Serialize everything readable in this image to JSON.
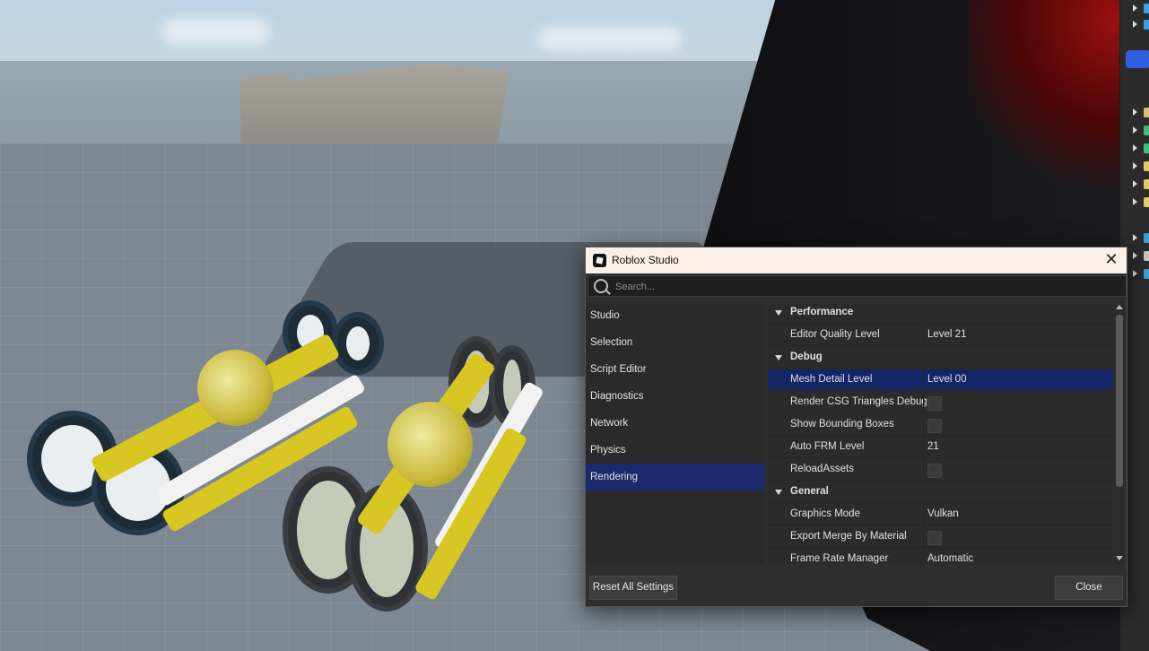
{
  "dialog": {
    "title": "Roblox Studio",
    "search": {
      "placeholder": "Search...",
      "value": ""
    },
    "categories": [
      {
        "label": "Studio",
        "active": false
      },
      {
        "label": "Selection",
        "active": false
      },
      {
        "label": "Script Editor",
        "active": false
      },
      {
        "label": "Diagnostics",
        "active": false
      },
      {
        "label": "Network",
        "active": false
      },
      {
        "label": "Physics",
        "active": false
      },
      {
        "label": "Rendering",
        "active": true
      }
    ],
    "sections": {
      "performance": {
        "label": "Performance",
        "rows": [
          {
            "name": "Editor Quality Level",
            "value": "Level 21"
          }
        ]
      },
      "debug": {
        "label": "Debug",
        "rows": [
          {
            "name": "Mesh Detail Level",
            "value": "Level 00",
            "selected": true
          },
          {
            "name": "Render CSG Triangles Debug",
            "checkbox": true,
            "checked": false
          },
          {
            "name": "Show Bounding Boxes",
            "checkbox": true,
            "checked": false
          },
          {
            "name": "Auto FRM Level",
            "value": "21"
          },
          {
            "name": "ReloadAssets",
            "checkbox": true,
            "checked": false
          }
        ]
      },
      "general": {
        "label": "General",
        "rows": [
          {
            "name": "Graphics Mode",
            "value": "Vulkan"
          },
          {
            "name": "Export Merge By Material",
            "checkbox": true,
            "checked": false
          },
          {
            "name": "Frame Rate Manager",
            "value": "Automatic"
          }
        ]
      }
    },
    "buttons": {
      "reset": "Reset All Settings",
      "close": "Close"
    }
  },
  "colors": {
    "selection": "#142566",
    "category_active": "#1a2a6c",
    "dialog_bg": "#2e2e2e",
    "titlebar_bg": "#fbf0e8"
  },
  "icons": {
    "app": "roblox-studio-logo-icon",
    "close": "close-icon",
    "search": "search-icon",
    "section": "chevron-down-icon"
  }
}
